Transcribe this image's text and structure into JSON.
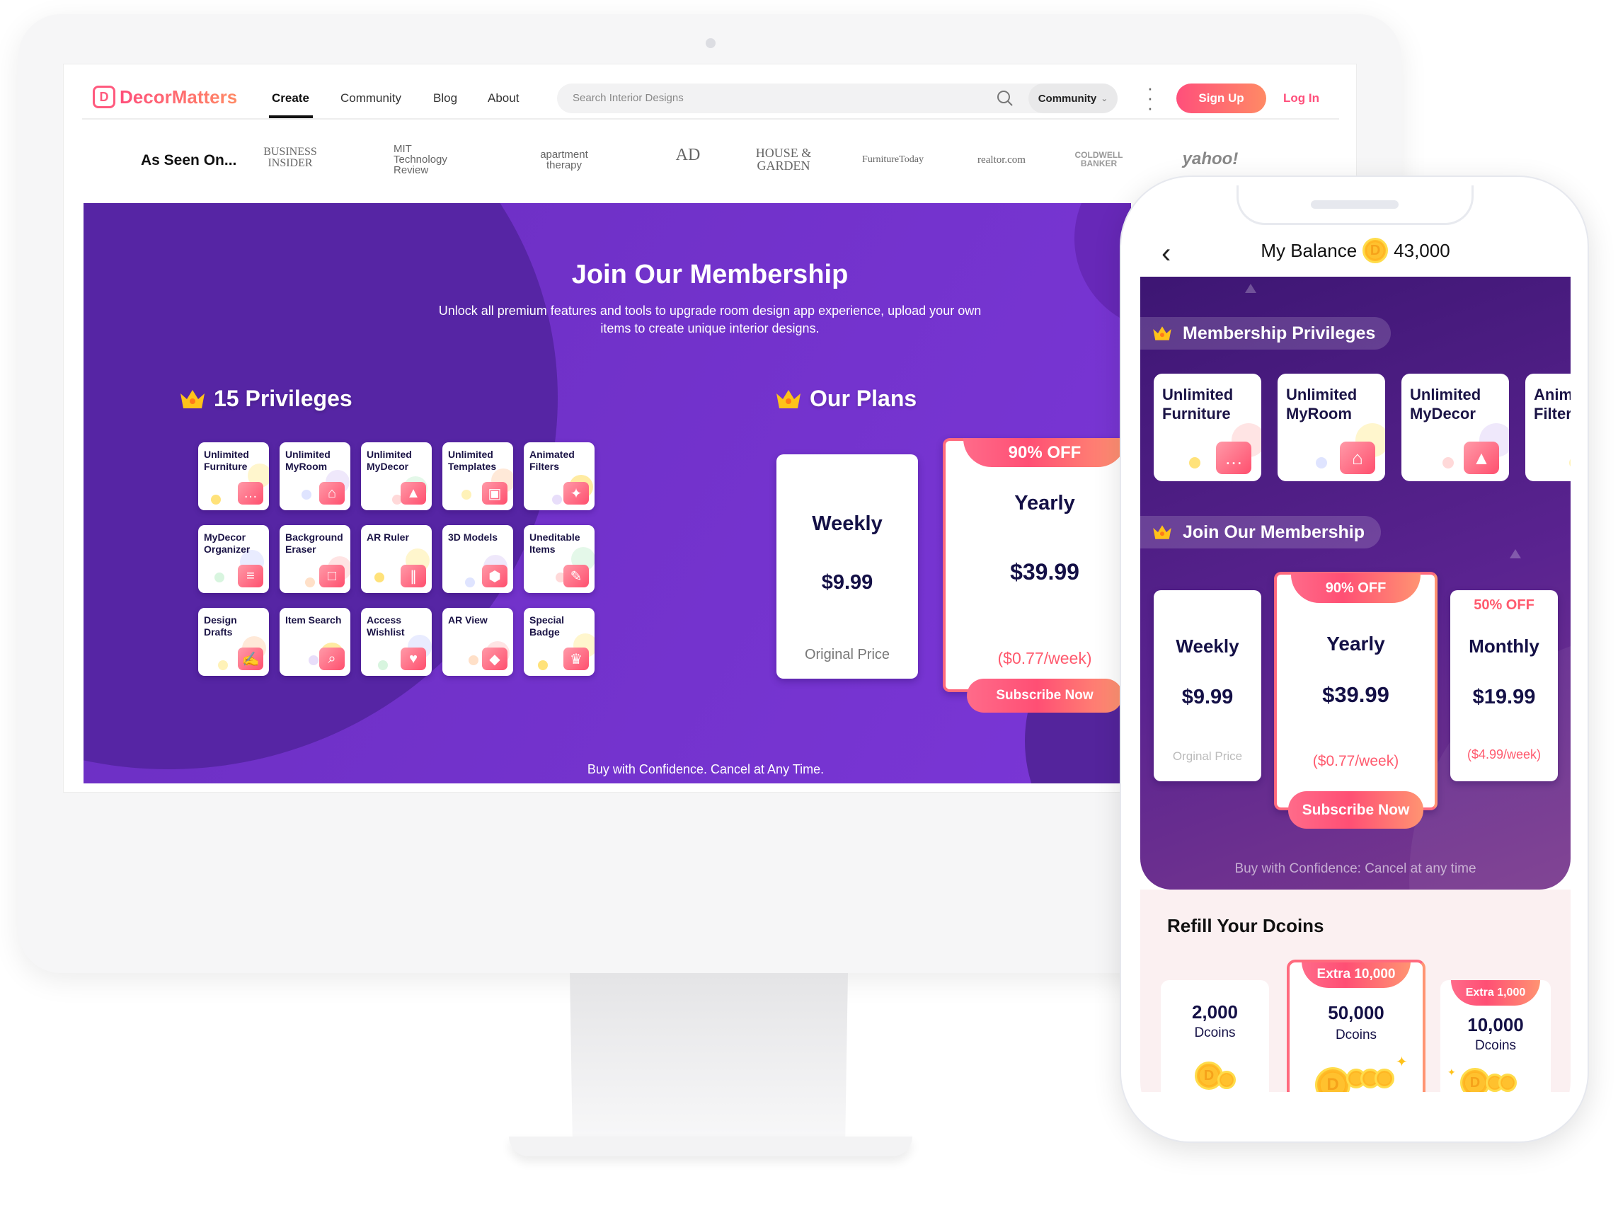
{
  "colors": {
    "accent": "#ff4f7b",
    "purple": "#6a2ec0",
    "navy": "#141046",
    "price_note": "#ff5a6e"
  },
  "web": {
    "brand": "DecorMatters",
    "brand_mark": "D",
    "nav": [
      "Create",
      "Community",
      "Blog",
      "About"
    ],
    "active_nav": "Create",
    "search": {
      "placeholder": "Search Interior Designs",
      "scope": "Community",
      "icon": "search-icon"
    },
    "sign_up": "Sign Up",
    "log_in": "Log In",
    "as_seen_on": "As Seen On...",
    "press": [
      "BUSINESS INSIDER",
      "MIT Technology Review",
      "apartment therapy",
      "AD",
      "HOUSE & GARDEN",
      "FurnitureToday",
      "realtor.com",
      "COLDWELL BANKER",
      "yahoo!"
    ],
    "banner": {
      "title": "Join Our Membership",
      "subtitle": "Unlock all premium features and tools to upgrade room design app experience, upload your own items to create unique interior designs.",
      "privileges_title": "15 Privileges",
      "plans_title": "Our Plans",
      "privileges": [
        {
          "label": "Unlimited Furniture",
          "icon": "sofa-icon"
        },
        {
          "label": "Unlimited MyRoom",
          "icon": "house-icon"
        },
        {
          "label": "Unlimited MyDecor",
          "icon": "vase-icon"
        },
        {
          "label": "Unlimited Templates",
          "icon": "image-icon"
        },
        {
          "label": "Animated Filters",
          "icon": "sparkle-icon"
        },
        {
          "label": "MyDecor Organizer",
          "icon": "layers-icon"
        },
        {
          "label": "Background Eraser",
          "icon": "eraser-icon"
        },
        {
          "label": "AR Ruler",
          "icon": "ruler-icon"
        },
        {
          "label": "3D Models",
          "icon": "cube-icon"
        },
        {
          "label": "Uneditable Items",
          "icon": "pencil-icon"
        },
        {
          "label": "Design Drafts",
          "icon": "draft-icon"
        },
        {
          "label": "Item Search",
          "icon": "magnifier-icon"
        },
        {
          "label": "Access Wishlist",
          "icon": "heart-bookmark-icon"
        },
        {
          "label": "AR View",
          "icon": "ar-cube-icon"
        },
        {
          "label": "Special Badge",
          "icon": "badge-icon"
        }
      ],
      "plans": [
        {
          "name": "Weekly",
          "price": "$9.99",
          "note": "Original Price"
        },
        {
          "name": "Yearly",
          "price": "$39.99",
          "note": "($0.77/week)",
          "badge": "90% OFF",
          "button": "Subscribe Now"
        }
      ],
      "confidence": "Buy with Confidence. Cancel at Any Time."
    }
  },
  "app": {
    "title": "My Balance",
    "balance": "43,000",
    "coin_letter": "D",
    "privileges_title": "Membership Privileges",
    "privileges": [
      {
        "label": "Unlimited Furniture",
        "icon": "sofa-icon"
      },
      {
        "label": "Unlimited MyRoom",
        "icon": "house-icon"
      },
      {
        "label": "Unlimited MyDecor",
        "icon": "vase-icon"
      },
      {
        "label": "Animated Filters",
        "icon": "sparkle-icon"
      }
    ],
    "membership_title": "Join Our Membership",
    "plans": [
      {
        "name": "Weekly",
        "price": "$9.99",
        "note": "Orginal Price"
      },
      {
        "name": "Yearly",
        "price": "$39.99",
        "note": "($0.77/week)",
        "badge": "90% OFF",
        "button": "Subscribe Now"
      },
      {
        "name": "Monthly",
        "price": "$19.99",
        "note": "($4.99/week)",
        "badge": "50% OFF"
      }
    ],
    "confidence": "Buy with Confidence: Cancel at any time",
    "refill_title": "Refill Your Dcoins",
    "refills": [
      {
        "amount": "2,000",
        "unit": "Dcoins"
      },
      {
        "amount": "50,000",
        "unit": "Dcoins",
        "badge": "Extra 10,000"
      },
      {
        "amount": "10,000",
        "unit": "Dcoins",
        "badge": "Extra 1,000"
      }
    ]
  }
}
